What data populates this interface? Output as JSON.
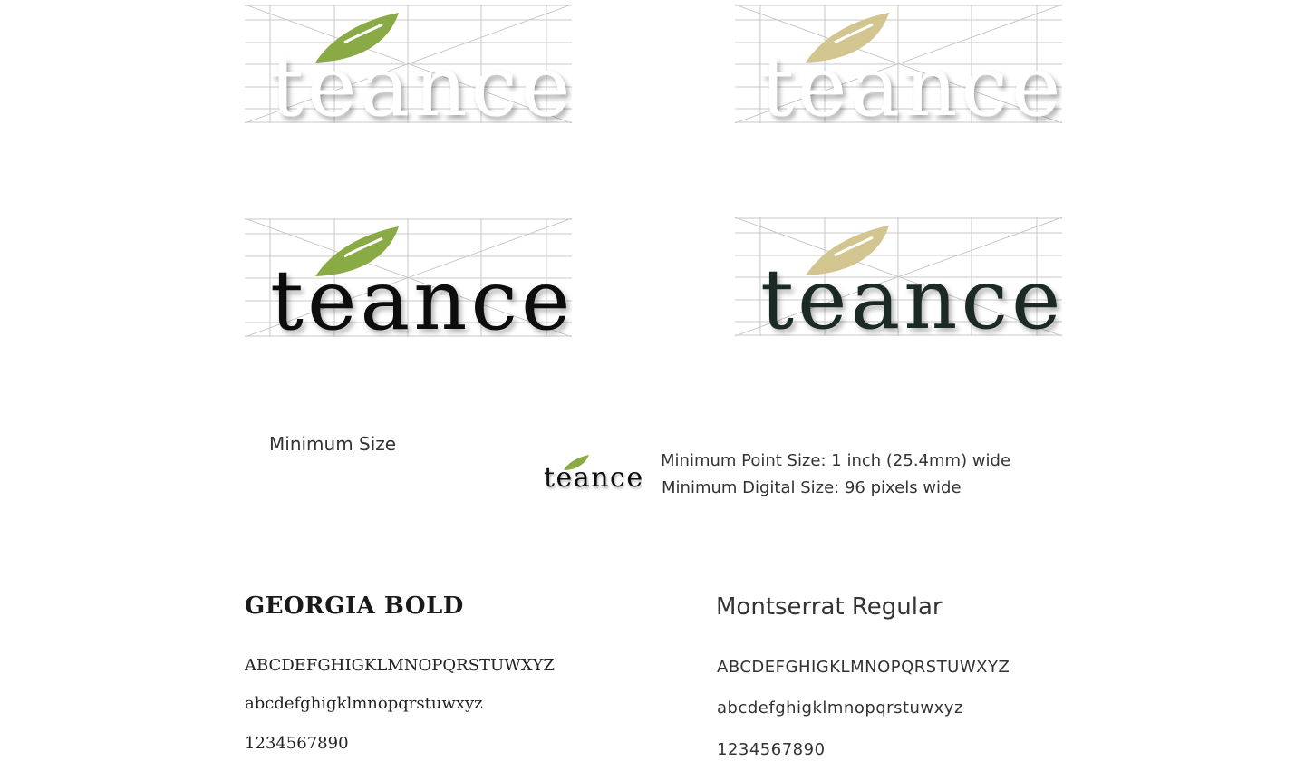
{
  "brand": {
    "wordmark": "teance",
    "colors": {
      "leaf_green": "#8aaa45",
      "leaf_tan": "#d2c58f",
      "ink_black": "#0a0a0a",
      "ink_dark_green": "#1d2a25",
      "grid": "#c8c8c8"
    }
  },
  "logos": [
    {
      "id": "white-green-leaf",
      "leaf": "leaf_green",
      "text_style": "ghost"
    },
    {
      "id": "white-tan-leaf",
      "leaf": "leaf_tan",
      "text_style": "ghost"
    },
    {
      "id": "black-green-leaf",
      "leaf": "leaf_green",
      "text_style": "ink-black"
    },
    {
      "id": "darkgreen-tan-leaf",
      "leaf": "leaf_tan",
      "text_style": "ink-green"
    }
  ],
  "minimum": {
    "title": "Minimum Size",
    "point_size": "Minimum Point Size: 1 inch (25.4mm) wide",
    "digital_size": "Minimum Digital Size: 96 pixels wide"
  },
  "fonts": {
    "georgia": {
      "title": "GEORGIA BOLD",
      "uppercase": "ABCDEFGHIGKLMNOPQRSTUWXYZ",
      "lowercase": "abcdefghigklmnopqrstuwxyz",
      "digits": "1234567890"
    },
    "montserrat": {
      "title": "Montserrat Regular",
      "uppercase": "ABCDEFGHIGKLMNOPQRSTUWXYZ",
      "lowercase": "abcdefghigklmnopqrstuwxyz",
      "digits": "1234567890"
    }
  }
}
